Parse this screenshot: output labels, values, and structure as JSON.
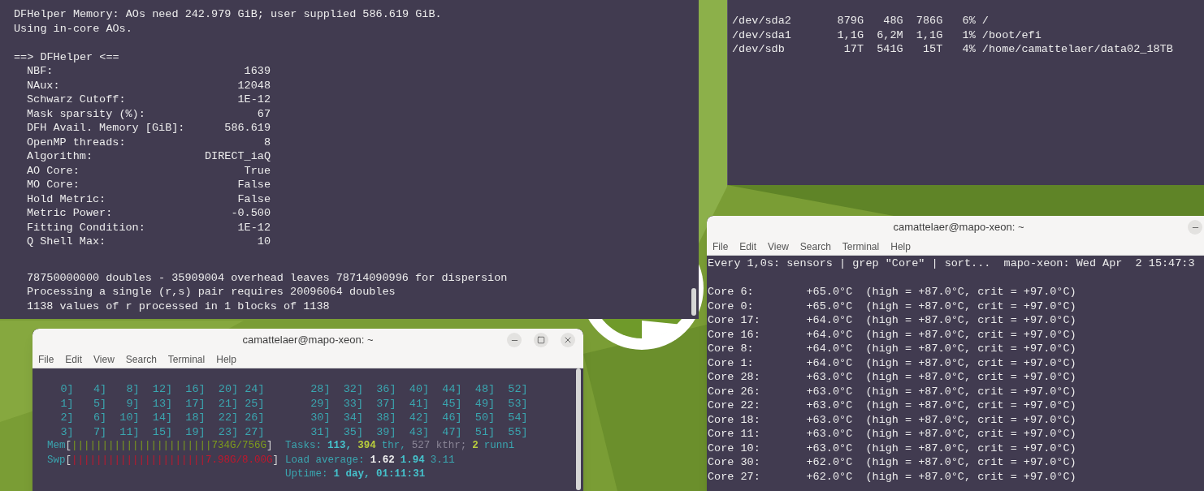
{
  "output_terminal": {
    "header_lines": [
      "DFHelper Memory: AOs need 242.979 GiB; user supplied 586.619 GiB.",
      "Using in-core AOs."
    ],
    "section_title": "==> DFHelper <==",
    "parameters": [
      {
        "label": "NBF:",
        "value": "1639"
      },
      {
        "label": "NAux:",
        "value": "12048"
      },
      {
        "label": "Schwarz Cutoff:",
        "value": "1E-12"
      },
      {
        "label": "Mask sparsity (%):",
        "value": "67"
      },
      {
        "label": "DFH Avail. Memory [GiB]:",
        "value": "586.619"
      },
      {
        "label": "OpenMP threads:",
        "value": "8"
      },
      {
        "label": "Algorithm:",
        "value": "DIRECT_iaQ"
      },
      {
        "label": "AO Core:",
        "value": "True"
      },
      {
        "label": "MO Core:",
        "value": "False"
      },
      {
        "label": "Hold Metric:",
        "value": "False"
      },
      {
        "label": "Metric Power:",
        "value": "-0.500"
      },
      {
        "label": "Fitting Condition:",
        "value": "1E-12"
      },
      {
        "label": "Q Shell Max:",
        "value": "10"
      }
    ],
    "footer_lines": [
      "78750000000 doubles - 35909004 overhead leaves 78714090996 for dispersion",
      "Processing a single (r,s) pair requires 20096064 doubles",
      "1138 values of r processed in 1 blocks of 1138"
    ]
  },
  "disk_terminal": {
    "lines": [
      "/dev/sda2       879G   48G  786G   6% /",
      "/dev/sda1       1,1G  6,2M  1,1G   1% /boot/efi",
      "/dev/sdb         17T  541G   15T   4% /home/camattelaer/data02_18TB"
    ]
  },
  "htop_window": {
    "title": "camattelaer@mapo-xeon: ~",
    "menu": [
      "File",
      "Edit",
      "View",
      "Search",
      "Terminal",
      "Help"
    ],
    "cpu_rows": [
      "    0]   4]   8]  12]  16]  20] 24]       28]  32]  36]  40]  44]  48]  52]",
      "    1]   5]   9]  13]  17]  21] 25]       29]  33]  37]  41]  45]  49]  53]",
      "    2]   6]  10]  14]  18]  22] 26]       30]  34]  38]  42]  46]  50]  54]",
      "    3]   7]  11]  15]  19]  23] 27]       31]  35]  39]  43]  47]  51]  55]"
    ],
    "meters": [
      {
        "segments": [
          {
            "text": "Mem",
            "kind": "label"
          },
          {
            "text": "[",
            "kind": "bracket"
          },
          {
            "text": "|||||||||||||||||||||||",
            "kind": "bar_green"
          },
          {
            "text": "734G/756G",
            "kind": "value_green"
          },
          {
            "text": "]",
            "kind": "bracket"
          }
        ]
      },
      {
        "segments": [
          {
            "text": "Swp",
            "kind": "label"
          },
          {
            "text": "[",
            "kind": "bracket"
          },
          {
            "text": "||||||||||||||||||||||",
            "kind": "bar_red"
          },
          {
            "text": "7.98G/8.00G",
            "kind": "value_red"
          },
          {
            "text": "]",
            "kind": "bracket"
          }
        ]
      }
    ],
    "info_lines": [
      {
        "segments": [
          {
            "text": "Tasks:",
            "kind": "label"
          },
          {
            "text": "113,",
            "kind": "strong"
          },
          {
            "text": "394",
            "kind": "highlight"
          },
          {
            "text": "thr,",
            "kind": "label"
          },
          {
            "text": "527 kthr;",
            "kind": "dim"
          },
          {
            "text": "2",
            "kind": "highlight"
          },
          {
            "text": "runni",
            "kind": "label"
          }
        ]
      },
      {
        "segments": [
          {
            "text": "Load average:",
            "kind": "label"
          },
          {
            "text": "1.62",
            "kind": "white"
          },
          {
            "text": "1.94",
            "kind": "strong"
          },
          {
            "text": "3.11",
            "kind": "label"
          }
        ]
      },
      {
        "segments": [
          {
            "text": "Uptime:",
            "kind": "label"
          },
          {
            "text": "1 day, 01:11:31",
            "kind": "strong"
          }
        ]
      }
    ]
  },
  "sensors_window": {
    "title": "camattelaer@mapo-xeon: ~",
    "menu": [
      "File",
      "Edit",
      "View",
      "Search",
      "Terminal",
      "Help"
    ],
    "header": "Every 1,0s: sensors | grep \"Core\" | sort...  mapo-xeon: Wed Apr  2 15:47:3",
    "lines": [
      "Core 6:        +65.0°C  (high = +87.0°C, crit = +97.0°C)",
      "Core 0:        +65.0°C  (high = +87.0°C, crit = +97.0°C)",
      "Core 17:       +64.0°C  (high = +87.0°C, crit = +97.0°C)",
      "Core 16:       +64.0°C  (high = +87.0°C, crit = +97.0°C)",
      "Core 8:        +64.0°C  (high = +87.0°C, crit = +97.0°C)",
      "Core 1:        +64.0°C  (high = +87.0°C, crit = +97.0°C)",
      "Core 28:       +63.0°C  (high = +87.0°C, crit = +97.0°C)",
      "Core 26:       +63.0°C  (high = +87.0°C, crit = +97.0°C)",
      "Core 22:       +63.0°C  (high = +87.0°C, crit = +97.0°C)",
      "Core 18:       +63.0°C  (high = +87.0°C, crit = +97.0°C)",
      "Core 11:       +63.0°C  (high = +87.0°C, crit = +97.0°C)",
      "Core 10:       +63.0°C  (high = +87.0°C, crit = +97.0°C)",
      "Core 30:       +62.0°C  (high = +87.0°C, crit = +97.0°C)",
      "Core 27:       +62.0°C  (high = +87.0°C, crit = +97.0°C)"
    ]
  }
}
